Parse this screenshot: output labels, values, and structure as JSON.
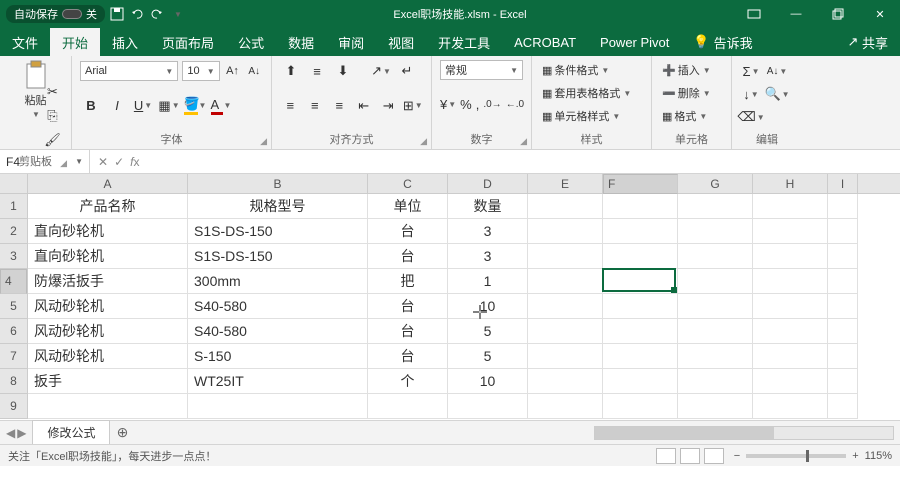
{
  "title": "Excel职场技能.xlsm  -  Excel",
  "autosave": {
    "label": "自动保存",
    "state": "关"
  },
  "qat_icons": [
    "save-icon",
    "undo-icon",
    "redo-icon",
    "dropdown-icon"
  ],
  "winbtns": [
    "ribbon-opts",
    "minimize",
    "restore",
    "close"
  ],
  "menu": {
    "file": "文件",
    "home": "开始",
    "insert": "插入",
    "page": "页面布局",
    "formulas": "公式",
    "data": "数据",
    "review": "审阅",
    "view": "视图",
    "dev": "开发工具",
    "acrobat": "ACROBAT",
    "pivot": "Power Pivot",
    "tell": "告诉我",
    "share": "共享"
  },
  "ribbon": {
    "clipboard": {
      "paste": "粘贴",
      "group": "剪贴板"
    },
    "font": {
      "name": "Arial",
      "size": "10",
      "group": "字体"
    },
    "align": {
      "group": "对齐方式"
    },
    "number": {
      "format": "常规",
      "group": "数字"
    },
    "styles": {
      "cond": "条件格式",
      "table": "套用表格格式",
      "cell": "单元格样式",
      "group": "样式"
    },
    "cells": {
      "insert": "插入",
      "delete": "删除",
      "format": "格式",
      "group": "单元格"
    },
    "editing": {
      "group": "编辑"
    }
  },
  "namebox": "F4",
  "formula": "",
  "columns": [
    {
      "l": "A",
      "w": 160
    },
    {
      "l": "B",
      "w": 180
    },
    {
      "l": "C",
      "w": 80
    },
    {
      "l": "D",
      "w": 80
    },
    {
      "l": "E",
      "w": 75
    },
    {
      "l": "F",
      "w": 75
    },
    {
      "l": "G",
      "w": 75
    },
    {
      "l": "H",
      "w": 75
    },
    {
      "l": "I",
      "w": 30
    }
  ],
  "rows": [
    {
      "n": 1,
      "c": {
        "A": "产品名称",
        "B": "规格型号",
        "C": "单位",
        "D": "数量"
      },
      "align": {
        "A": "center",
        "B": "center",
        "C": "center",
        "D": "center"
      }
    },
    {
      "n": 2,
      "c": {
        "A": "直向砂轮机",
        "B": "S1S-DS-150",
        "C": "台",
        "D": "3"
      }
    },
    {
      "n": 3,
      "c": {
        "A": "直向砂轮机",
        "B": "S1S-DS-150",
        "C": "台",
        "D": "3"
      }
    },
    {
      "n": 4,
      "c": {
        "A": "防爆活扳手",
        "B": "300mm",
        "C": "把",
        "D": "1"
      }
    },
    {
      "n": 5,
      "c": {
        "A": "风动砂轮机",
        "B": "S40-580",
        "C": "台",
        "D": "10"
      }
    },
    {
      "n": 6,
      "c": {
        "A": "风动砂轮机",
        "B": "S40-580",
        "C": "台",
        "D": "5"
      }
    },
    {
      "n": 7,
      "c": {
        "A": "风动砂轮机",
        "B": "S-150",
        "C": "台",
        "D": "5"
      }
    },
    {
      "n": 8,
      "c": {
        "A": "扳手",
        "B": "WT25IT",
        "C": "个",
        "D": "10"
      }
    },
    {
      "n": 9,
      "c": {}
    }
  ],
  "active": {
    "col": "F",
    "row": 4
  },
  "sheet": {
    "name": "修改公式",
    "add": "⊕"
  },
  "status": {
    "msg": "关注「Excel职场技能」，每天进步一点点！",
    "zoom": "115%"
  }
}
